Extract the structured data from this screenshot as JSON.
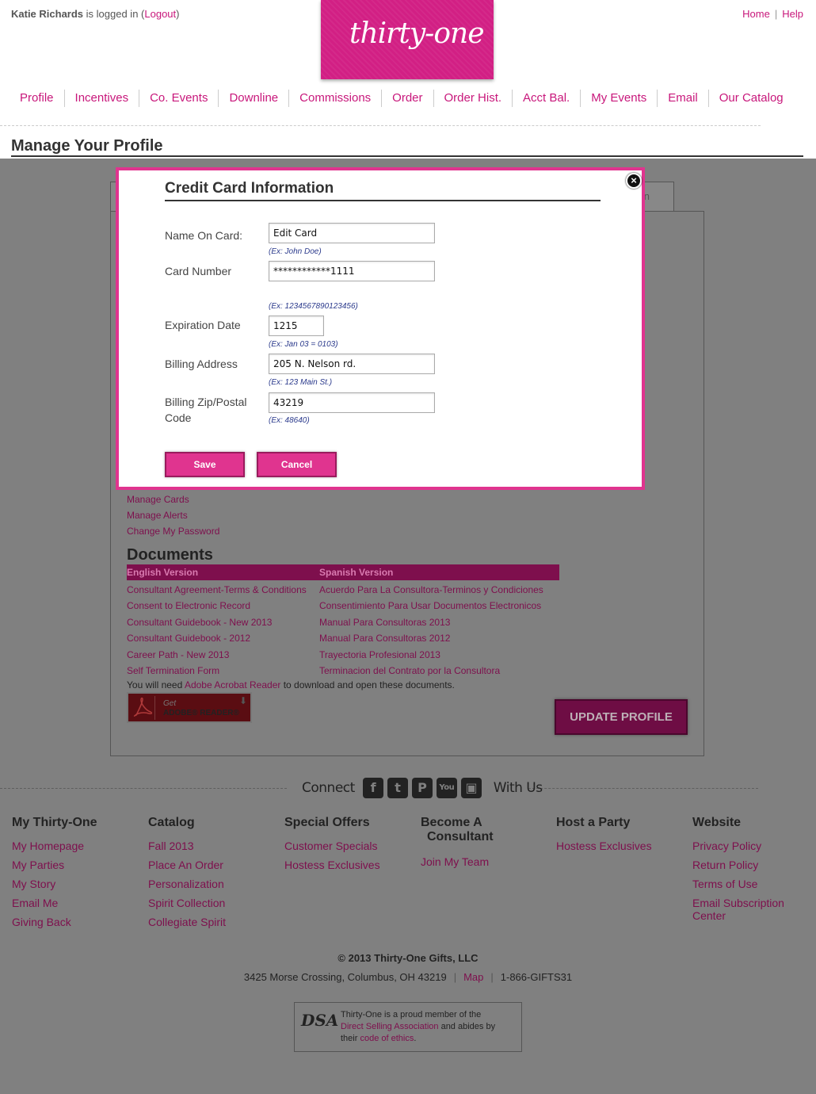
{
  "header": {
    "user_name": "Katie Richards",
    "login_text": " is logged in (",
    "logout_label": "Logout",
    "login_close": ")",
    "home_label": "Home",
    "help_label": "Help",
    "logo_text": "thirty-one",
    "brand_color": "#d21f84"
  },
  "nav": [
    "Profile",
    "Incentives",
    "Co. Events",
    "Downline",
    "Commissions",
    "Order",
    "Order Hist.",
    "Acct Bal.",
    "My Events",
    "Email",
    "Our Catalog"
  ],
  "page_title": "Manage Your Profile",
  "tab_stub_label": "n",
  "account_links": [
    "Manage Cards",
    "Manage Alerts",
    "Change My Password"
  ],
  "documents": {
    "title": "Documents",
    "english_header": "English Version",
    "spanish_header": "Spanish Version",
    "english": [
      "Consultant Agreement-Terms & Conditions",
      "Consent to Electronic Record",
      "Consultant Guidebook - New 2013",
      "Consultant Guidebook - 2012",
      "Career Path - New 2013",
      "Self Termination Form"
    ],
    "spanish": [
      "Acuerdo Para La Consultora-Terminos y Condiciones",
      "Consentimiento Para Usar Documentos Electronicos",
      "Manual Para Consultoras 2013",
      "Manual Para Consultoras 2012",
      "Trayectoria Profesional 2013",
      "Terminacion del Contrato por la Consultora"
    ],
    "need_prefix": "You will need ",
    "need_link": "Adobe Acrobat Reader",
    "need_suffix": " to download and open these documents.",
    "adobe_get": "Get",
    "adobe_reader": "ADOBE® READER®"
  },
  "update_button": "UPDATE PROFILE",
  "modal": {
    "title": "Credit Card Information",
    "close_glyph": "×",
    "name_label": "Name On Card:",
    "name_value": "Edit Card",
    "name_hint": "(Ex: John Doe)",
    "card_label": "Card Number",
    "card_value": "************1111",
    "card_hint": "(Ex: 1234567890123456)",
    "exp_label": "Expiration Date",
    "exp_value": "1215",
    "exp_hint": "(Ex: Jan 03 = 0103)",
    "addr_label": "Billing Address",
    "addr_value": "205 N. Nelson rd.",
    "addr_hint": "(Ex: 123 Main St.)",
    "zip_label_1": "Billing Zip/Postal",
    "zip_label_2": "Code",
    "zip_value": "43219",
    "zip_hint": "(Ex: 48640)",
    "save_label": "Save",
    "cancel_label": "Cancel",
    "accent": "#e0348f"
  },
  "connect": {
    "connect_label": "Connect",
    "with_us_label": "With Us",
    "icons": [
      "facebook-icon",
      "twitter-icon",
      "pinterest-icon",
      "youtube-icon",
      "instagram-icon"
    ],
    "icon_glyphs": [
      "f",
      "t",
      "P",
      "You",
      "▣"
    ]
  },
  "footer": {
    "my_thirty_one": {
      "title": "My Thirty-One",
      "links": [
        "My Homepage",
        "My Parties",
        "My Story",
        "Email Me",
        "Giving Back"
      ]
    },
    "catalog": {
      "title": "Catalog",
      "links": [
        "Fall 2013",
        "Place An Order",
        "Personalization",
        "Spirit Collection",
        "Collegiate Spirit"
      ]
    },
    "special_offers": {
      "title": "Special Offers",
      "links": [
        "Customer Specials",
        "Hostess Exclusives"
      ]
    },
    "become": {
      "title_1": "Become A",
      "title_2": "Consultant",
      "links": [
        "Join My Team"
      ]
    },
    "host": {
      "title": "Host a Party",
      "links": [
        "Hostess Exclusives"
      ]
    },
    "website": {
      "title": "Website",
      "links": [
        "Privacy Policy",
        "Return Policy",
        "Terms of Use"
      ],
      "last_1": "Email Subscription",
      "last_2": "Center"
    },
    "copyright": "© 2013 Thirty-One Gifts, LLC",
    "address": "3425 Morse Crossing, Columbus, OH 43219",
    "map_label": "Map",
    "phone": "1-866-GIFTS31",
    "dsa_mark": "DSA",
    "dsa_line1": "Thirty-One is a proud member of the",
    "dsa_link": "Direct Selling Association",
    "dsa_line2": " and abides by",
    "dsa_line3a": "their ",
    "dsa_line3_link": "code of ethics",
    "dsa_line3b": "."
  }
}
